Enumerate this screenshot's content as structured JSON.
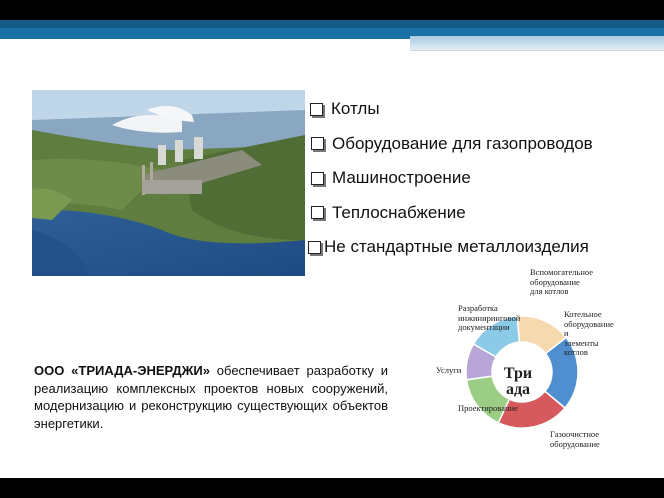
{
  "bullets": [
    "Котлы",
    "Оборудование для газопроводов",
    "Машиностроение",
    "Теплоснабжение",
    "Не стандартные металлоизделия"
  ],
  "description": {
    "company": "ООО «ТРИАДА-ЭНЕРДЖИ»",
    "text": " обеспечивает разработку и реализацию комплексных проектов новых сооружений, модернизацию и реконструкцию существующих объектов энергетики."
  },
  "diagram": {
    "center": "Три ада",
    "segments": [
      {
        "label": "Вспомогательное оборудование для котлов",
        "color": "#f7d9b0"
      },
      {
        "label": "Котельное оборудование и элементы котлов",
        "color": "#4f8fd0"
      },
      {
        "label": "Газоочистное оборудование",
        "color": "#d6595d"
      },
      {
        "label": "Проектирование",
        "color": "#9ccd84"
      },
      {
        "label": "Услуги",
        "color": "#b8a6d8"
      },
      {
        "label": "Разработка инжиниринговой документации",
        "color": "#8ccbe8"
      }
    ],
    "labels": {
      "top": "Вспомогательное оборудование для котлов",
      "right": "Котельное оборудование и элементы котлов",
      "bottom": "Газоочистное оборудование",
      "left_top": "Разработка инжиниринговой документации",
      "left": "Услуги",
      "left_bottom": "Проектирование"
    }
  }
}
